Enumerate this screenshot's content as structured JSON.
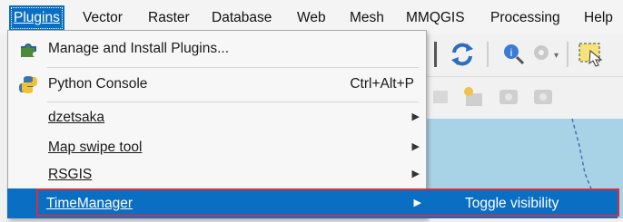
{
  "menubar": {
    "items": [
      {
        "label": "Plugins",
        "mnemonic_index": 0
      },
      {
        "label": "Vector",
        "mnemonic_index": 4
      },
      {
        "label": "Raster",
        "mnemonic_index": 0
      },
      {
        "label": "Database",
        "mnemonic_index": 0
      },
      {
        "label": "Web",
        "mnemonic_index": 0
      },
      {
        "label": "Mesh",
        "mnemonic_index": 0
      },
      {
        "label": "MMQGIS",
        "mnemonic_index": -1
      },
      {
        "label": "Processing",
        "mnemonic_index": 3
      },
      {
        "label": "Help",
        "mnemonic_index": 0
      }
    ],
    "active_index": 0
  },
  "plugins_menu": {
    "items": [
      {
        "label": "Manage and Install Plugins...",
        "icon": "puzzle-plugin-icon"
      },
      {
        "label": "Python Console",
        "shortcut": "Ctrl+Alt+P",
        "icon": "python-icon"
      },
      {
        "label": "dzetsaka",
        "submenu": true
      },
      {
        "label": "Map swipe tool",
        "submenu": true
      },
      {
        "label": "RSGIS",
        "submenu": true
      },
      {
        "label": "TimeManager",
        "submenu": true,
        "highlighted": true
      }
    ]
  },
  "timemanager_submenu": {
    "items": [
      {
        "label": "Toggle visibility",
        "highlighted": true
      }
    ]
  },
  "colors": {
    "highlight": "#0a6fc2",
    "annotation_box": "#d6303f",
    "map_canvas": "#a8d3e6"
  }
}
